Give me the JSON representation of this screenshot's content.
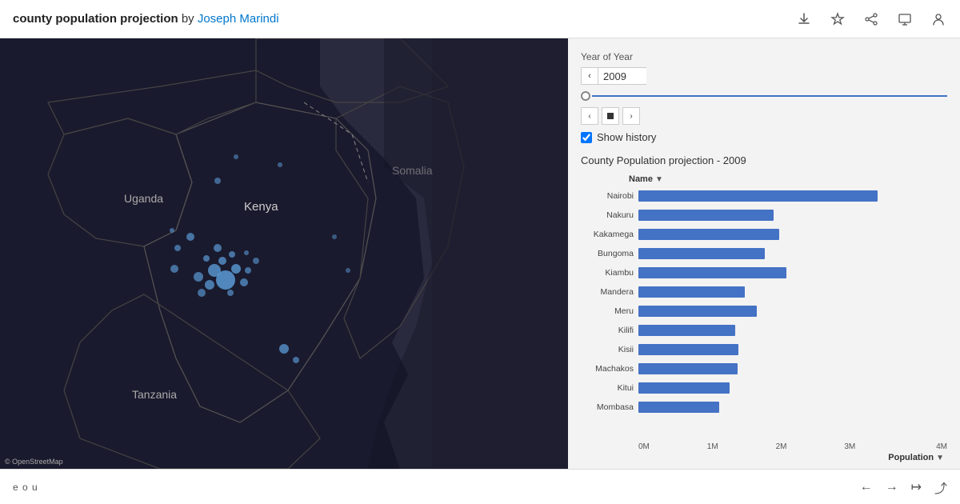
{
  "header": {
    "title_plain": "county population projection",
    "by_text": "by",
    "author_name": "Joseph Marindi"
  },
  "header_icons": [
    {
      "name": "download-icon",
      "symbol": "⬇"
    },
    {
      "name": "star-icon",
      "symbol": "☆"
    },
    {
      "name": "share-icon",
      "symbol": "⤴"
    },
    {
      "name": "present-icon",
      "symbol": "🖥"
    },
    {
      "name": "user-icon",
      "symbol": "👤"
    }
  ],
  "controls": {
    "year_label": "Year of Year",
    "year_value": "2009",
    "show_history_label": "Show history",
    "show_history_checked": true
  },
  "chart": {
    "title": "County Population projection - 2009",
    "name_column_label": "Name",
    "axis_label": "Population",
    "x_ticks": [
      "0M",
      "1M",
      "2M",
      "3M",
      "4M"
    ],
    "max_value": 4000000,
    "bars": [
      {
        "name": "Nairobi",
        "value": 3100000
      },
      {
        "name": "Nakuru",
        "value": 1750000
      },
      {
        "name": "Kakamega",
        "value": 1820000
      },
      {
        "name": "Bungoma",
        "value": 1640000
      },
      {
        "name": "Kiambu",
        "value": 1920000
      },
      {
        "name": "Mandera",
        "value": 1380000
      },
      {
        "name": "Meru",
        "value": 1530000
      },
      {
        "name": "Kilifi",
        "value": 1250000
      },
      {
        "name": "Kisii",
        "value": 1300000
      },
      {
        "name": "Machakos",
        "value": 1280000
      },
      {
        "name": "Kitui",
        "value": 1180000
      },
      {
        "name": "Mombasa",
        "value": 1050000
      }
    ]
  },
  "footer": {
    "left_text": "e o u",
    "nav_buttons": [
      "←",
      "→",
      "⇥",
      "⤴"
    ]
  },
  "map": {
    "credits": "© OpenStreetMap"
  }
}
